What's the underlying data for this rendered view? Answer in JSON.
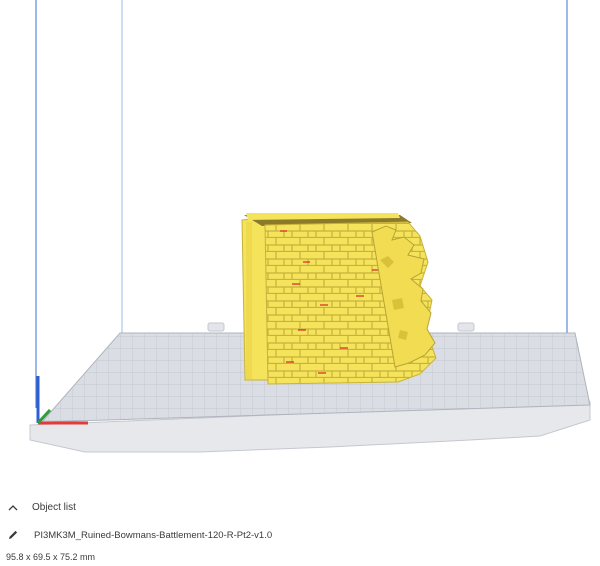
{
  "object_list": {
    "header_label": "Object list",
    "toggle_icon": "chevron-up-icon",
    "edit_icon": "pencil-icon",
    "object_name": "PI3MK3M_Ruined-Bowmans-Battlement-120-R-Pt2-v1.0",
    "dimensions": "95.8 x 69.5 x 75.2 mm"
  },
  "colors": {
    "model_fill": "#f5e35c",
    "model_shadow": "#d9c23a",
    "overhang": "#d6262a",
    "build_plate": "#cfd3da",
    "build_volume_lines": "#3b6fd6",
    "axis_x": "#e23b3b",
    "axis_y": "#2e9e3a",
    "axis_z": "#2f5fd0"
  }
}
